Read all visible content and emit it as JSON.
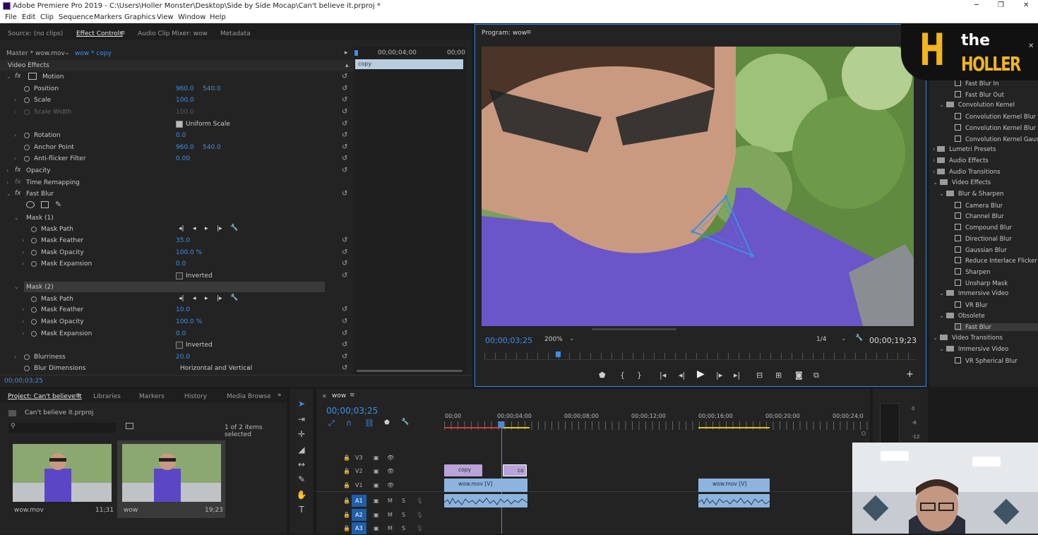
{
  "window": {
    "title": "Adobe Premiere Pro 2019 - C:\\Users\\Holler Monster\\Desktop\\Side by Side Mocap\\Can't believe it.prproj *",
    "minimize": "─",
    "maximize": "❐",
    "close": "✕"
  },
  "menu": [
    "File",
    "Edit",
    "Clip",
    "Sequence",
    "Markers",
    "Graphics",
    "View",
    "Window",
    "Help"
  ],
  "source_panel": {
    "tabs": [
      "Source: (no clips)",
      "Effect Controls",
      "Audio Clip Mixer: wow",
      "Metadata"
    ],
    "master_clip": "Master * wow.mov",
    "seq_clip": "wow * copy",
    "ruler_time": "00;00;04;00",
    "ruler_end": "00;00",
    "clip_label": "copy",
    "timecode": "00;00;03;25"
  },
  "effects": {
    "video_effects": "Video Effects",
    "motion": "Motion",
    "position": "Position",
    "position_x": "960.0",
    "position_y": "540.0",
    "scale": "Scale",
    "scale_val": "100.0",
    "scale_width": "Scale Width",
    "scale_width_val": "100.0",
    "uniform_scale": "Uniform Scale",
    "rotation": "Rotation",
    "rotation_val": "0.0",
    "anchor_point": "Anchor Point",
    "anchor_x": "960.0",
    "anchor_y": "540.0",
    "anti_flicker": "Anti-flicker Filter",
    "anti_flicker_val": "0.00",
    "opacity": "Opacity",
    "time_remapping": "Time Remapping",
    "fast_blur": "Fast Blur",
    "mask1": "Mask (1)",
    "mask2": "Mask (2)",
    "mask_path": "Mask Path",
    "mask_feather": "Mask Feather",
    "mask_opacity": "Mask Opacity",
    "mask_expansion": "Mask Expansion",
    "inverted": "Inverted",
    "m1_feather": "35.0",
    "m1_opacity": "100.0 %",
    "m1_expansion": "0.0",
    "m2_feather": "10.0",
    "m2_opacity": "100.0 %",
    "m2_expansion": "0.0",
    "blurriness": "Blurriness",
    "blurriness_val": "20.0",
    "blur_dimensions": "Blur Dimensions",
    "blur_dimensions_val": "Horizontal and Vertical"
  },
  "program": {
    "title": "Program: wow",
    "timecode": "00;00;03;25",
    "zoom": "200%",
    "resolution": "1/4",
    "duration": "00;00;19;23"
  },
  "effects_panel": {
    "items": [
      {
        "text": "Fast Blur In",
        "type": "fx",
        "indent": 2
      },
      {
        "text": "Fast Blur Out",
        "type": "fx",
        "indent": 2
      },
      {
        "text": "Convolution Kernel",
        "type": "folder",
        "indent": 1
      },
      {
        "text": "Convolution Kernel Blur",
        "type": "fx",
        "indent": 2
      },
      {
        "text": "Convolution Kernel Blur M",
        "type": "fx",
        "indent": 2
      },
      {
        "text": "Convolution Kernel Gaussi",
        "type": "fx",
        "indent": 2
      },
      {
        "text": "Lumetri Presets",
        "type": "folder",
        "indent": 0
      },
      {
        "text": "Audio Effects",
        "type": "folder",
        "indent": 0
      },
      {
        "text": "Audio Transitions",
        "type": "folder",
        "indent": 0
      },
      {
        "text": "Video Effects",
        "type": "folder",
        "indent": 0
      },
      {
        "text": "Blur & Sharpen",
        "type": "folder",
        "indent": 1
      },
      {
        "text": "Camera Blur",
        "type": "fx",
        "indent": 2
      },
      {
        "text": "Channel Blur",
        "type": "fx",
        "indent": 2
      },
      {
        "text": "Compound Blur",
        "type": "fx",
        "indent": 2
      },
      {
        "text": "Directional Blur",
        "type": "fx",
        "indent": 2
      },
      {
        "text": "Gaussian Blur",
        "type": "fx",
        "indent": 2
      },
      {
        "text": "Reduce Interlace Flicker",
        "type": "fx",
        "indent": 2
      },
      {
        "text": "Sharpen",
        "type": "fx",
        "indent": 2
      },
      {
        "text": "Unsharp Mask",
        "type": "fx",
        "indent": 2
      },
      {
        "text": "Immersive Video",
        "type": "folder",
        "indent": 1
      },
      {
        "text": "VR Blur",
        "type": "fx",
        "indent": 2
      },
      {
        "text": "Obsolete",
        "type": "folder",
        "indent": 1
      },
      {
        "text": "Fast Blur",
        "type": "fx",
        "indent": 2
      },
      {
        "text": "Video Transitions",
        "type": "folder",
        "indent": 0
      },
      {
        "text": "Immersive Video",
        "type": "folder",
        "indent": 1
      },
      {
        "text": "VR Spherical Blur",
        "type": "fx",
        "indent": 2
      }
    ]
  },
  "logo": {
    "letter": "H",
    "line1": "the",
    "line2": "HOLLER"
  },
  "project": {
    "tabs": [
      "Project: Can't believe it",
      "Libraries",
      "Markers",
      "History",
      "Media Browse"
    ],
    "file": "Can't believe it.prproj",
    "selection": "1 of 2 items selected",
    "items": [
      {
        "name": "wow.mov",
        "duration": "11;31"
      },
      {
        "name": "wow",
        "duration": "19;23"
      }
    ]
  },
  "timeline": {
    "seq": "wow",
    "timecode": "00;00;03;25",
    "ruler": [
      "00;00",
      "00;00;04;00",
      "00;00;08;00",
      "00;00;12;00",
      "00;00;16;00",
      "00;00;20;00",
      "00;00;24;0"
    ],
    "tracks": [
      "V3",
      "V2",
      "V1",
      "A1",
      "A2",
      "A3"
    ],
    "clips": {
      "copy": "copy",
      "co": "co",
      "v1a": "wow.mov [V]",
      "v1b": "wow.mov [V]"
    },
    "meter": [
      "0",
      "-6",
      "-12"
    ]
  }
}
